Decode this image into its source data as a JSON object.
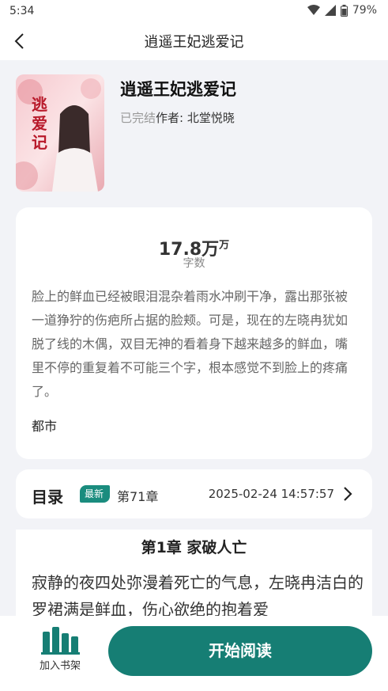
{
  "status_bar": {
    "time": "5:34",
    "battery": "79%"
  },
  "nav": {
    "title": "逍遥王妃逃爱记"
  },
  "book": {
    "name": "逍遥王妃逃爱记",
    "status": "已完结",
    "author": "作者: 北堂悦晓",
    "cover_text": "逃爱记"
  },
  "info": {
    "word_count": "17.8万",
    "word_count_unit": "万",
    "word_count_label": "字数",
    "description": "脸上的鲜血已经被眼泪混杂着雨水冲刷干净，露出那张被一道狰狞的伤疤所占据的脸颊。可是，现在的左晓冉犹如脱了线的木偶，双目无神的看着身下越来越多的鲜血，嘴里不停的重复着不可能三个字，根本感觉不到脸上的疼痛了。",
    "tag": "都市"
  },
  "toc": {
    "label": "目录",
    "badge": "最新",
    "latest_chapter": "第71章",
    "date": "2025-02-24 14:57:57"
  },
  "chapter": {
    "title": "第1章 家破人亡",
    "text": "寂静的夜四处弥漫着死亡的气息，左晓冉洁白的罗裙满是鲜血，伤心欲绝的抱着爱"
  },
  "bottom": {
    "shelf_label": "加入书架",
    "read_label": "开始阅读"
  },
  "colors": {
    "accent": "#167e74",
    "background": "#f2f3f7"
  }
}
